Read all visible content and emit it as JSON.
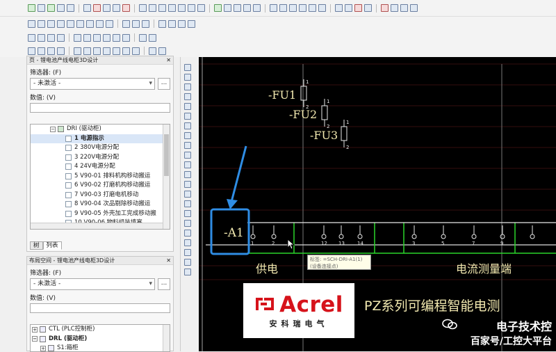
{
  "panel_top": {
    "title": "页 - 锂电池产线电柜3D设计",
    "filter_label": "筛选器: (F)",
    "filter_value": "- 未激活 -",
    "filter_button": "...",
    "value_label": "数值: (V)",
    "tree_parent": "DRI (驱动柜)",
    "pages": [
      "1 电源指示",
      "2 380V电源分配",
      "3 220V电源分配",
      "4 24V电源分配",
      "5 V90-01 排料机构移动搬运",
      "6 V90-02 打磨机构移动搬运",
      "7 V90-03 打磨电机移动",
      "8 V90-04 次品剔除移动搬运",
      "9 V90-05 外壳加工完成移动搬",
      "10 V90-06 物料组装填塞"
    ],
    "tabs": [
      "树",
      "列表"
    ]
  },
  "panel_bottom": {
    "title": "布局空间 - 锂电池产线电柜3D设计",
    "filter_label": "筛选器: (F)",
    "filter_value": "- 未激活 -",
    "filter_button": "...",
    "value_label": "数值: (V)",
    "tree": [
      "CTL (PLC控制柜)",
      "DRL (驱动柜)",
      "S1:箱柜"
    ]
  },
  "canvas": {
    "fuses": [
      "-FU1",
      "-FU2",
      "-FU3"
    ],
    "fuse_terms_top": [
      "1",
      "1",
      "1"
    ],
    "fuse_terms_bot": [
      "2",
      "2",
      "2"
    ],
    "device_tag": "-A1",
    "terminal_numbers": [
      "1",
      "2",
      "12",
      "13",
      "14",
      "3",
      "5",
      "7",
      "9"
    ],
    "section_supply": "供电",
    "section_current": "电流测量端",
    "product_title": "PZ系列可编程智能电测",
    "tooltip_line1": "标签: =SCH-DRI-A1(1)",
    "tooltip_line2": "(设备连接点)"
  },
  "logo": {
    "brand": "Acrel",
    "sub": "安科瑞电气"
  },
  "watermark": {
    "line1": "电子技术控",
    "line2": "百家号/工控大平台"
  },
  "colors": {
    "canvas_bg": "#000000",
    "wire_green": "#2bd62b",
    "symbol_white": "#e8e8e8",
    "highlight_blue": "#2f8de4",
    "logo_red": "#d6131b",
    "yellow_text": "#f2e9b0"
  }
}
